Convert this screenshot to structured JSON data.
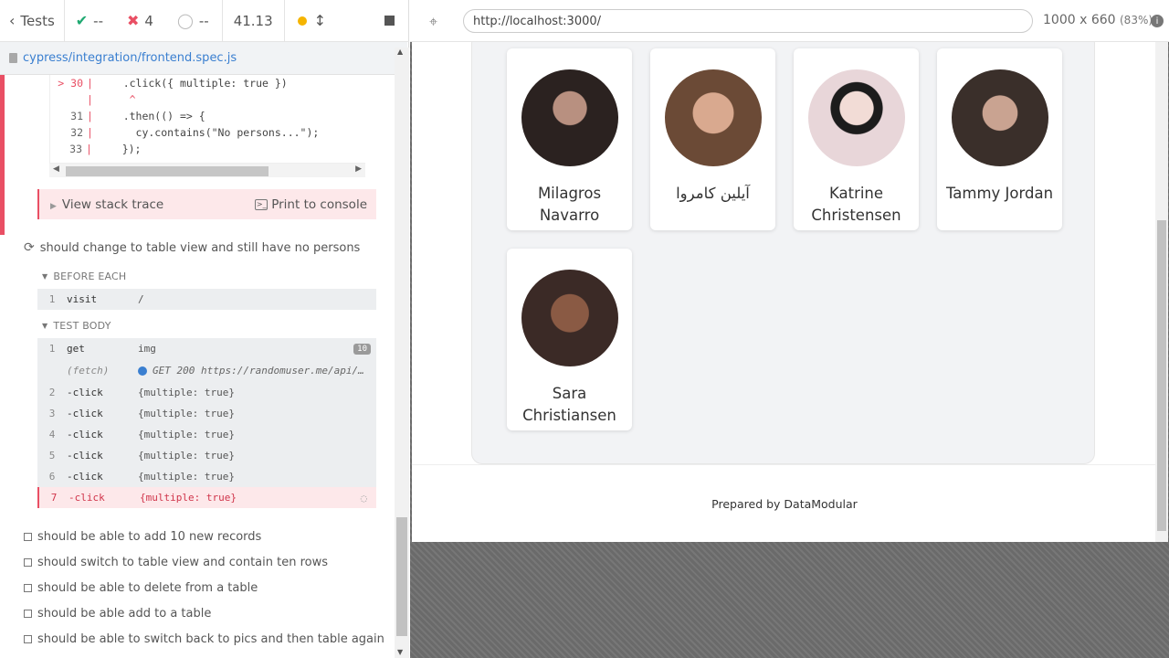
{
  "runner": {
    "back_label": "Tests",
    "passed": "--",
    "failed": "4",
    "pending": "--",
    "duration": "41.13",
    "spec_file": "cypress/integration/frontend.spec.js"
  },
  "code": {
    "lines": [
      {
        "num": "> 30",
        "text": "    .click({ multiple: true })"
      },
      {
        "num": "",
        "text": "     ^"
      },
      {
        "num": "31",
        "text": "    .then(() => {"
      },
      {
        "num": "32",
        "text": "      cy.contains(\"No persons...\");"
      },
      {
        "num": "33",
        "text": "    });"
      }
    ]
  },
  "stack": {
    "view_label": "View stack trace",
    "print_label": "Print to console"
  },
  "test": {
    "title": "should change to table view and still have no persons",
    "before_each_label": "BEFORE EACH",
    "test_body_label": "TEST BODY",
    "before_each": [
      {
        "n": "1",
        "cmd": "visit",
        "arg": "/"
      }
    ],
    "commands": [
      {
        "n": "1",
        "cmd": "get",
        "arg": "img"
      },
      {
        "n": "",
        "cmd": "(fetch)",
        "arg": "GET 200 https://randomuser.me/api/…"
      },
      {
        "n": "2",
        "cmd": "-click",
        "arg": "{multiple: true}"
      },
      {
        "n": "3",
        "cmd": "-click",
        "arg": "{multiple: true}"
      },
      {
        "n": "4",
        "cmd": "-click",
        "arg": "{multiple: true}"
      },
      {
        "n": "5",
        "cmd": "-click",
        "arg": "{multiple: true}"
      },
      {
        "n": "6",
        "cmd": "-click",
        "arg": "{multiple: true}"
      },
      {
        "n": "7",
        "cmd": "-click",
        "arg": "{multiple: true}"
      }
    ],
    "get_count": "10"
  },
  "pending_tests": [
    "should be able to add 10 new records",
    "should switch to table view and contain ten rows",
    "should be able to delete from a table",
    "should be able add to a table",
    "should be able to switch back to pics and then table again"
  ],
  "browser": {
    "url": "http://localhost:3000/",
    "viewport": "1000 x 660",
    "zoom": "(83%)"
  },
  "persons": [
    {
      "name": "Milagros Navarro",
      "color": "#2b2220"
    },
    {
      "name": "آیلین کامروا",
      "color": "#6b4a36"
    },
    {
      "name": "Katrine Christensen",
      "color": "#e8d6d9"
    },
    {
      "name": "Tammy Jordan",
      "color": "#3a2f2a"
    },
    {
      "name": "Sara Christiansen",
      "color": "#3b2a26"
    }
  ],
  "footer": "Prepared by DataModular",
  "colors": {
    "fail": "#e94f64",
    "pass": "#1fa971",
    "pending_dot": "#f5b400",
    "link": "#3a7fd0"
  }
}
